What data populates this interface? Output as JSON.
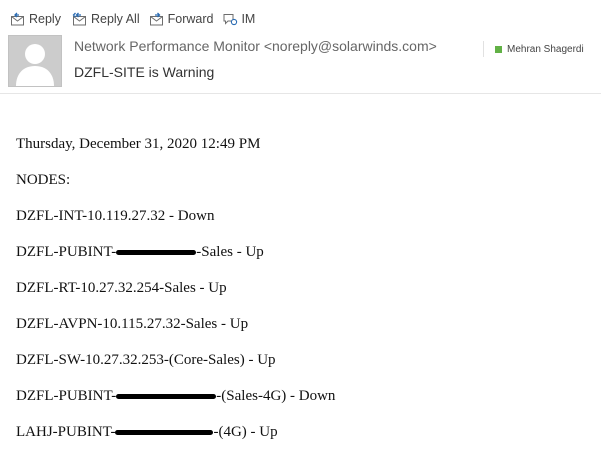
{
  "toolbar": {
    "reply": "Reply",
    "reply_all": "Reply All",
    "forward": "Forward",
    "im": "IM"
  },
  "header": {
    "sender": "Network Performance Monitor <noreply@solarwinds.com>",
    "subject": "DZFL-SITE is Warning",
    "recipient": "Mehran Shagerdi",
    "presence_color": "#62b146"
  },
  "message": {
    "date": "Thursday, December 31, 2020 12:49 PM",
    "section_heading": "NODES:",
    "lines": [
      {
        "text": "DZFL-INT-10.119.27.32 - Down"
      },
      {
        "before": "DZFL-PUBINT-",
        "after": "-Sales - Up",
        "redacted": true
      },
      {
        "text": "DZFL-RT-10.27.32.254-Sales - Up"
      },
      {
        "text": "DZFL-AVPN-10.115.27.32-Sales - Up"
      },
      {
        "text": "DZFL-SW-10.27.32.253-(Core-Sales) - Up"
      },
      {
        "before": "DZFL-PUBINT-",
        "after": "-(Sales-4G) - Down",
        "redacted": true
      },
      {
        "before": "LAHJ-PUBINT-",
        "after": "-(4G) - Up",
        "redacted": true
      }
    ]
  }
}
